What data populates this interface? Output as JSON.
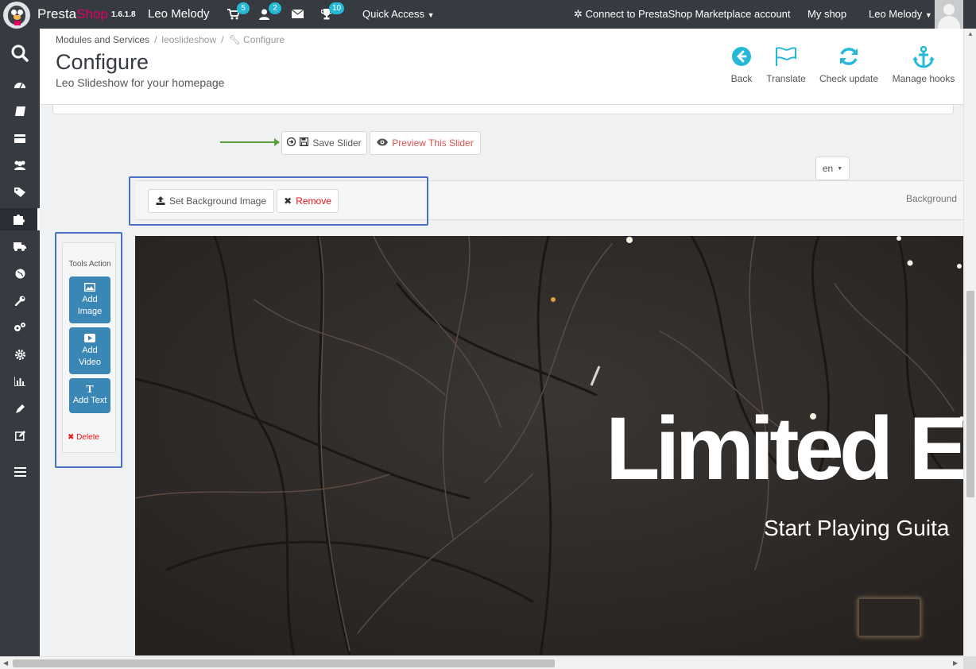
{
  "topbar": {
    "brand_presta": "Presta",
    "brand_shop": "Shop",
    "version": "1.6.1.8",
    "shop_name": "Leo Melody",
    "orders_badge": "5",
    "customers_badge": "2",
    "notifications_badge": "10",
    "quick_access": "Quick Access",
    "marketplace_link": "Connect to PrestaShop Marketplace account",
    "my_shop": "My shop",
    "user_name": "Leo Melody"
  },
  "breadcrumb": {
    "item1": "Modules and Services",
    "item2": "leoslideshow",
    "item3": "Configure"
  },
  "header": {
    "title": "Configure",
    "subtitle": "Leo Slideshow for your homepage",
    "toolbar": {
      "back": "Back",
      "translate": "Translate",
      "check_update": "Check update",
      "manage_hooks": "Manage hooks"
    }
  },
  "actions": {
    "save_slider": "Save Slider",
    "preview_slider": "Preview This Slider",
    "language": "en"
  },
  "background": {
    "set_image": "Set Background Image",
    "remove": "Remove",
    "label": "Background"
  },
  "tools": {
    "title": "Tools Action",
    "add_image_l1": "Add",
    "add_image_l2": "Image",
    "add_video_l1": "Add",
    "add_video_l2": "Video",
    "add_text": "Add Text",
    "delete": "Delete"
  },
  "slide": {
    "title": "Limited E",
    "subtitle": "Start Playing Guita"
  },
  "colors": {
    "topbar": "#363a41",
    "accent": "#25b9d7",
    "brand_pink": "#df0067",
    "tool_button": "#3a86b4",
    "highlight": "#4a6fc4",
    "danger": "#e11111"
  }
}
